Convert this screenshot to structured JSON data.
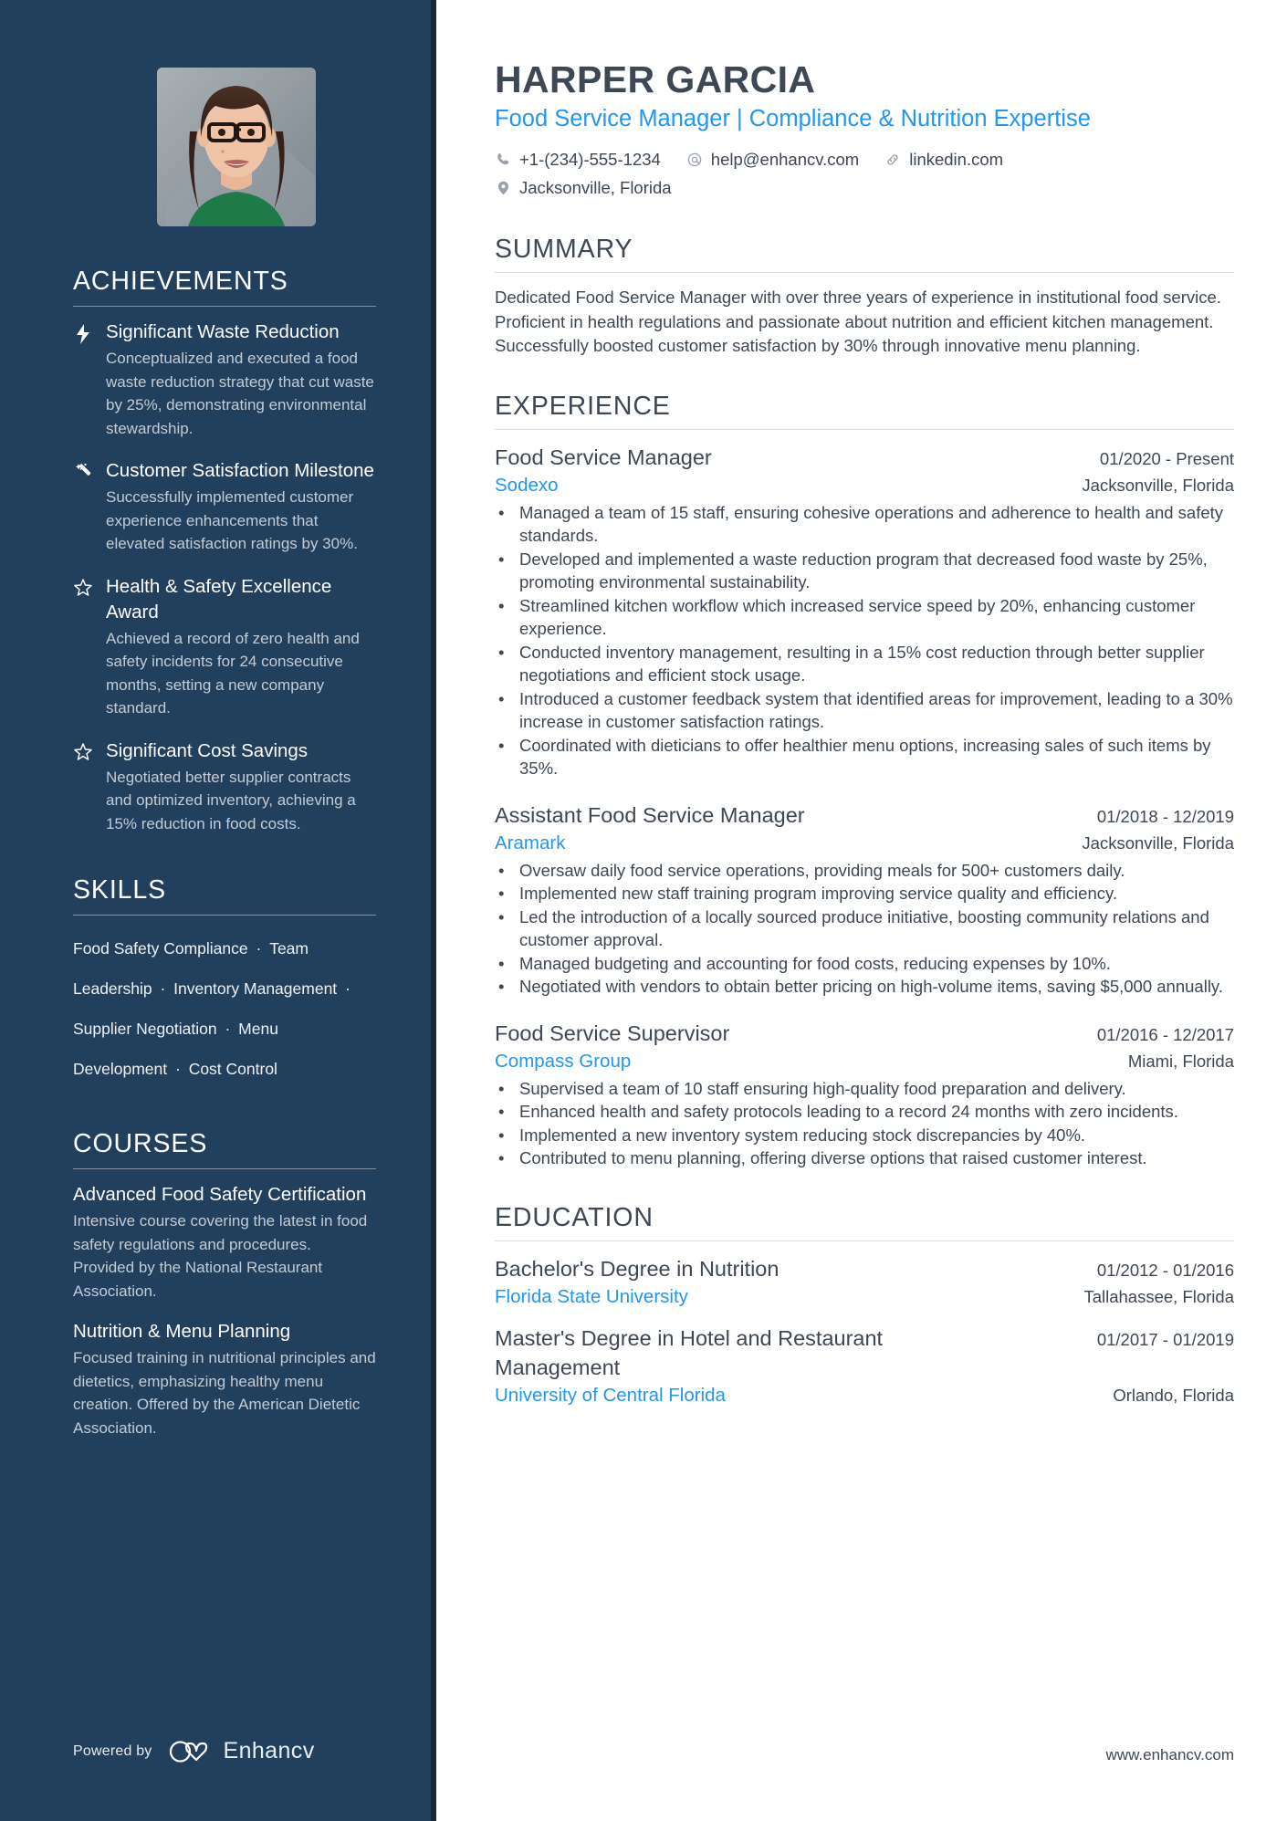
{
  "header": {
    "name": "HARPER GARCIA",
    "headline": "Food Service Manager | Compliance & Nutrition Expertise",
    "contacts": [
      {
        "icon": "phone-icon",
        "text": "+1-(234)-555-1234"
      },
      {
        "icon": "email-icon",
        "text": "help@enhancv.com"
      },
      {
        "icon": "link-icon",
        "text": "linkedin.com"
      },
      {
        "icon": "location-icon",
        "text": "Jacksonville, Florida"
      }
    ],
    "photo_alt": "profile-photo"
  },
  "sidebar": {
    "achievements": {
      "title": "ACHIEVEMENTS",
      "items": [
        {
          "icon": "bolt-icon",
          "title": "Significant Waste Reduction",
          "desc": "Conceptualized and executed a food waste reduction strategy that cut waste by 25%, demonstrating environmental stewardship."
        },
        {
          "icon": "magic-wand-icon",
          "title": "Customer Satisfaction Milestone",
          "desc": "Successfully implemented customer experience enhancements that elevated satisfaction ratings by 30%."
        },
        {
          "icon": "star-icon",
          "title": "Health & Safety Excellence Award",
          "desc": "Achieved a record of zero health and safety incidents for 24 consecutive months, setting a new company standard."
        },
        {
          "icon": "star-icon",
          "title": "Significant Cost Savings",
          "desc": "Negotiated better supplier contracts and optimized inventory, achieving a 15% reduction in food costs."
        }
      ]
    },
    "skills": {
      "title": "SKILLS",
      "separator": "·",
      "items": [
        "Food Safety Compliance",
        "Team Leadership",
        "Inventory Management",
        "Supplier Negotiation",
        "Menu Development",
        "Cost Control"
      ]
    },
    "courses": {
      "title": "COURSES",
      "items": [
        {
          "title": "Advanced Food Safety Certification",
          "desc": "Intensive course covering the latest in food safety regulations and procedures. Provided by the National Restaurant Association."
        },
        {
          "title": "Nutrition & Menu Planning",
          "desc": "Focused training in nutritional principles and dietetics, emphasizing healthy menu creation. Offered by the American Dietetic Association."
        }
      ]
    },
    "footer": {
      "powered_by": "Powered by",
      "brand": "Enhancv"
    }
  },
  "main": {
    "summary": {
      "title": "SUMMARY",
      "text": "Dedicated Food Service Manager with over three years of experience in institutional food service. Proficient in health regulations and passionate about nutrition and efficient kitchen management. Successfully boosted customer satisfaction by 30% through innovative menu planning."
    },
    "experience": {
      "title": "EXPERIENCE",
      "jobs": [
        {
          "title": "Food Service Manager",
          "date": "01/2020 - Present",
          "company": "Sodexo",
          "location": "Jacksonville, Florida",
          "bullets": [
            "Managed a team of 15 staff, ensuring cohesive operations and adherence to health and safety standards.",
            "Developed and implemented a waste reduction program that decreased food waste by 25%, promoting environmental sustainability.",
            "Streamlined kitchen workflow which increased service speed by 20%, enhancing customer experience.",
            "Conducted inventory management, resulting in a 15% cost reduction through better supplier negotiations and efficient stock usage.",
            "Introduced a customer feedback system that identified areas for improvement, leading to a 30% increase in customer satisfaction ratings.",
            "Coordinated with dieticians to offer healthier menu options, increasing sales of such items by 35%."
          ]
        },
        {
          "title": "Assistant Food Service Manager",
          "date": "01/2018 - 12/2019",
          "company": "Aramark",
          "location": "Jacksonville, Florida",
          "bullets": [
            "Oversaw daily food service operations, providing meals for 500+ customers daily.",
            "Implemented new staff training program improving service quality and efficiency.",
            "Led the introduction of a locally sourced produce initiative, boosting community relations and customer approval.",
            "Managed budgeting and accounting for food costs, reducing expenses by 10%.",
            "Negotiated with vendors to obtain better pricing on high-volume items, saving $5,000 annually."
          ]
        },
        {
          "title": "Food Service Supervisor",
          "date": "01/2016 - 12/2017",
          "company": "Compass Group",
          "location": "Miami, Florida",
          "bullets": [
            "Supervised a team of 10 staff ensuring high-quality food preparation and delivery.",
            "Enhanced health and safety protocols leading to a record 24 months with zero incidents.",
            "Implemented a new inventory system reducing stock discrepancies by 40%.",
            "Contributed to menu planning, offering diverse options that raised customer interest."
          ]
        }
      ]
    },
    "education": {
      "title": "EDUCATION",
      "items": [
        {
          "title": "Bachelor's Degree in Nutrition",
          "date": "01/2012 - 01/2016",
          "school": "Florida State University",
          "location": "Tallahassee, Florida"
        },
        {
          "title": "Master's Degree in Hotel and Restaurant Management",
          "date": "01/2017 - 01/2019",
          "school": "University of Central Florida",
          "location": "Orlando, Florida"
        }
      ]
    },
    "footer": {
      "website": "www.enhancv.com"
    }
  },
  "colors": {
    "sidebar_bg": "#21405e",
    "sidebar_edge": "#14293d",
    "accent_blue": "#2196f3",
    "body_text": "#3e4855",
    "muted_text": "#c3ccd5"
  },
  "bullet_glyph": "•"
}
